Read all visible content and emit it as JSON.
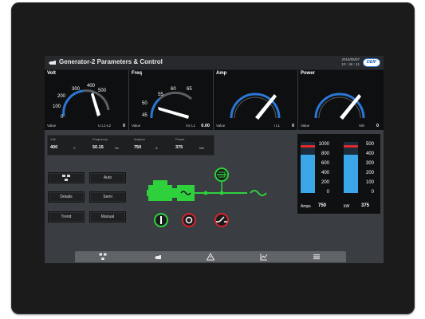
{
  "header": {
    "title": "Generator-2 Parameters & Control",
    "date": "2016/05/07",
    "time": "10 : 46 : 41",
    "logo": "DEIF"
  },
  "gauges": [
    {
      "title": "Volt",
      "ticks": [
        "0",
        "100",
        "200",
        "300",
        "400",
        "500"
      ],
      "value_label": "Value",
      "unit": "U L1-L2",
      "value": "0"
    },
    {
      "title": "Freq",
      "ticks": [
        "45",
        "50",
        "55",
        "60",
        "65"
      ],
      "value_label": "Value",
      "unit": "Hz  L1",
      "value": "0.00"
    },
    {
      "title": "Amp",
      "ticks": [],
      "value_label": "Value",
      "unit": "I  L1",
      "value": "0"
    },
    {
      "title": "Power",
      "ticks": [],
      "value_label": "Value",
      "unit": "kW",
      "value": "0"
    }
  ],
  "readings": {
    "headers": [
      "Volt",
      "Frequency",
      "Ampere",
      "Power"
    ],
    "values": [
      "400",
      "50.15",
      "750",
      "375"
    ],
    "units": [
      "V",
      "Hz",
      "A",
      "kW"
    ]
  },
  "buttons": {
    "icon_btn": "",
    "auto": "Auto",
    "details": "Details",
    "semi": "Semi",
    "trend": "Trend",
    "manual": "Manual"
  },
  "bars": {
    "amps_scale": [
      "1000",
      "800",
      "600",
      "400",
      "200",
      "0"
    ],
    "kw_scale": [
      "500",
      "400",
      "300",
      "200",
      "100",
      "0"
    ],
    "amps_label": "Amps",
    "amps_value": "750",
    "kw_label": "kW",
    "kw_value": "375",
    "amps_fill": 0.75,
    "kw_fill": 0.75
  },
  "colors": {
    "green": "#2ed13c",
    "red": "#d8232a",
    "bar_blue": "#3aa6e8",
    "bar_red": "#e02b2b",
    "gauge_arc": "#2b77d6"
  },
  "nav": [
    "overview-icon",
    "engine-icon",
    "alarm-icon",
    "trend-icon",
    "menu-icon"
  ]
}
